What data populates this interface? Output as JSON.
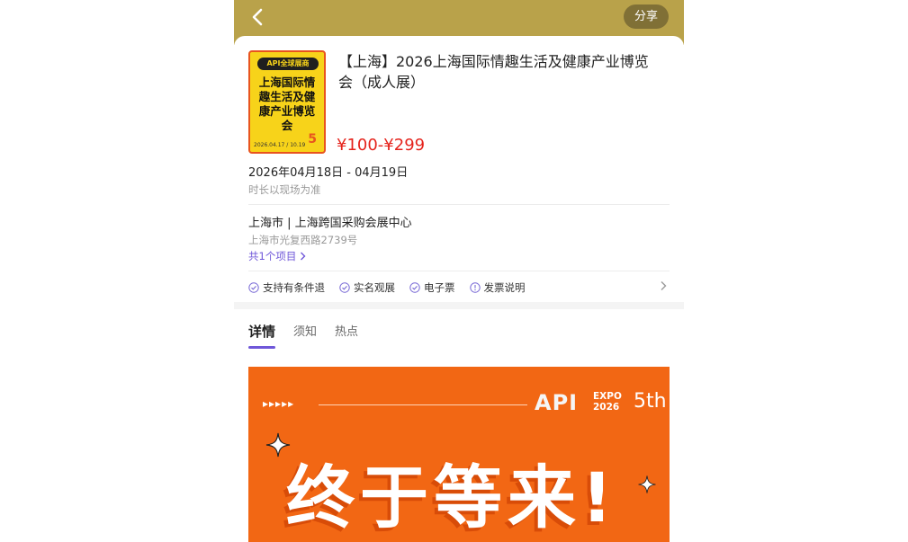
{
  "header": {
    "share_label": "分享"
  },
  "event": {
    "poster": {
      "logo_text": "API全球展商",
      "title_text": "上海国际情趣生活及健康产业博览会",
      "date_text": "2026.04.17 / 10.19",
      "badge": "5"
    },
    "title": "【上海】2026上海国际情趣生活及健康产业博览会（成人展）",
    "price": "¥100-¥299",
    "date_range": "2026年04月18日 - 04月19日",
    "duration_note": "时长以现场为准",
    "venue": "上海市 | 上海跨国采购会展中心",
    "address": "上海市光复西路2739号",
    "items_link": "共1个项目",
    "features": [
      {
        "label": "支持有条件退",
        "icon": "check-circle-icon"
      },
      {
        "label": "实名观展",
        "icon": "check-circle-icon"
      },
      {
        "label": "电子票",
        "icon": "check-circle-icon"
      },
      {
        "label": "发票说明",
        "icon": "info-circle-icon"
      }
    ]
  },
  "tabs": [
    {
      "label": "详情",
      "active": true
    },
    {
      "label": "须知",
      "active": false
    },
    {
      "label": "热点",
      "active": false
    }
  ],
  "banner": {
    "arrows": "▸▸▸▸▸",
    "brand": "API",
    "expo_line1": "EXPO",
    "expo_line2": "2026",
    "edition": "5th",
    "headline": "终于等来!"
  },
  "colors": {
    "topbar": "#b9a24a",
    "price": "#e5231c",
    "accent": "#6f57d9",
    "banner": "#f26714"
  }
}
